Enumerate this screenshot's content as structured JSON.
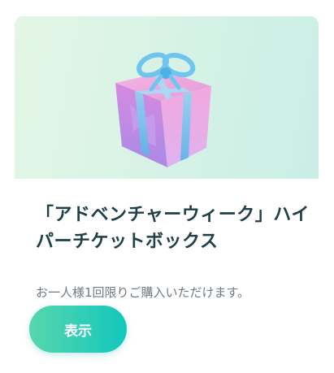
{
  "product": {
    "title": "「アドベンチャーウィーク」ハイパーチケットボックス",
    "description": "お一人様1回限りご購入いただけます。",
    "button_label": "表示",
    "image_icon": "gift-box-icon"
  },
  "colors": {
    "title": "#1f4049",
    "description": "#707a80",
    "button_start": "#58d6ae",
    "button_end": "#12c7bd",
    "banner_bg": "#d8f3e6"
  }
}
